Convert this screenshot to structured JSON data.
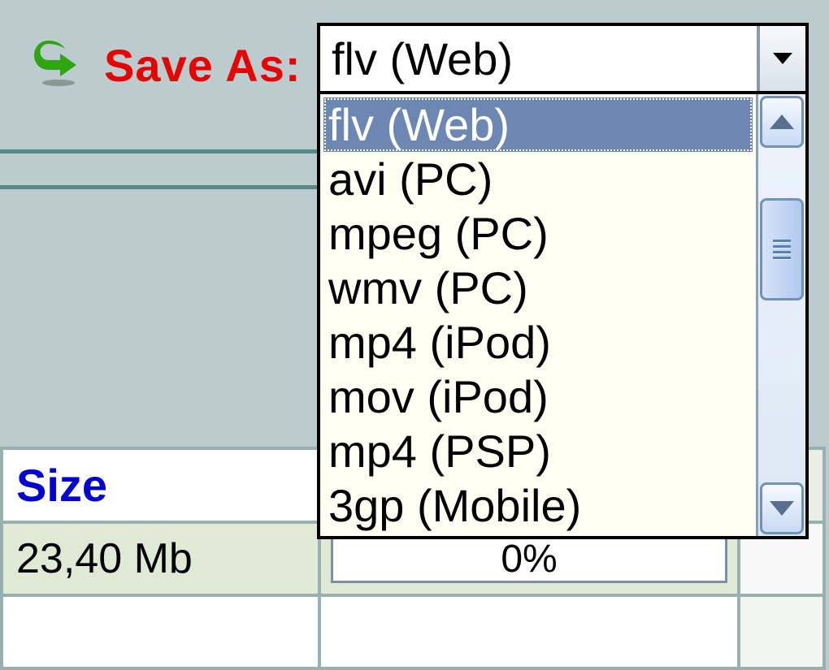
{
  "save_as": {
    "label": "Save As:",
    "icon_name": "save-arrow-icon",
    "selected": "flv (Web)",
    "options": [
      "flv (Web)",
      "avi (PC)",
      "mpeg (PC)",
      "wmv (PC)",
      "mp4 (iPod)",
      "mov (iPod)",
      "mp4 (PSP)",
      "3gp (Mobile)"
    ]
  },
  "table": {
    "headers": {
      "size": "Size"
    },
    "row": {
      "size": "23,40 Mb",
      "progress": "0%"
    }
  }
}
